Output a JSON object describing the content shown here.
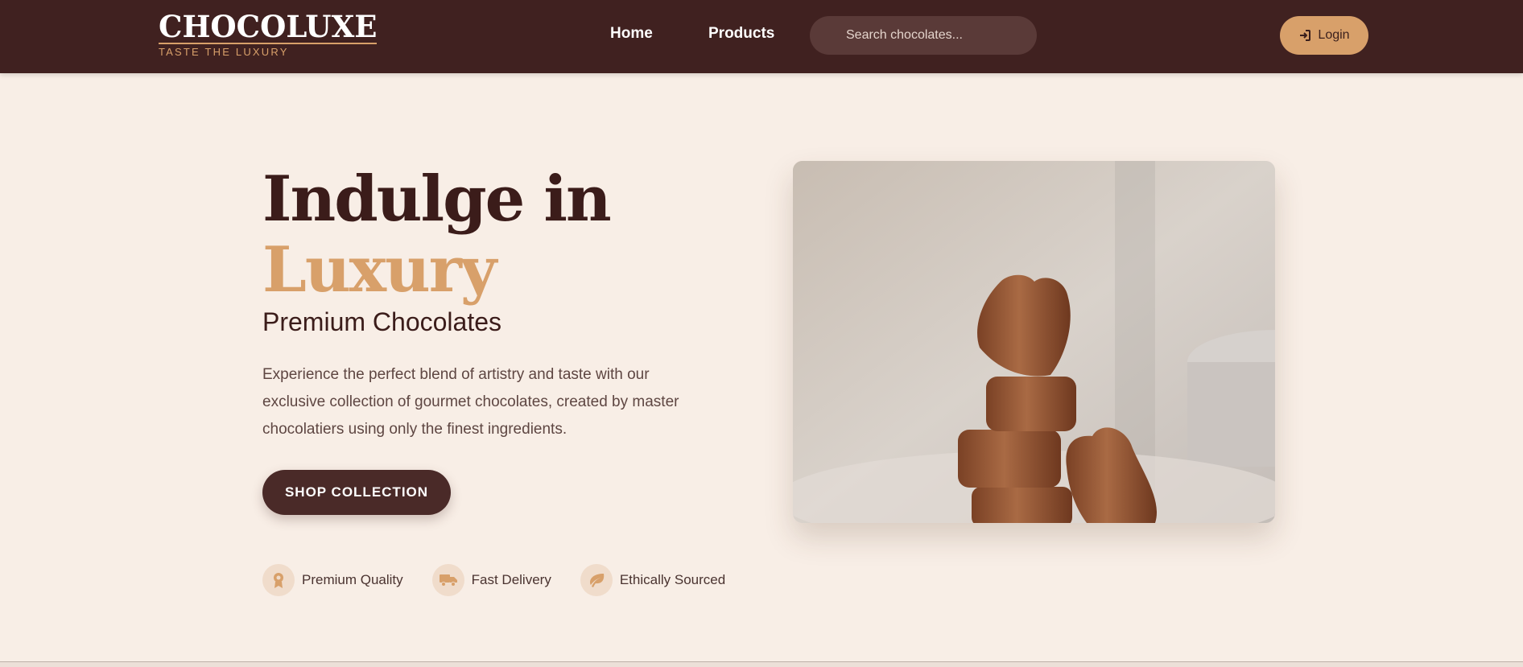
{
  "brand": {
    "name": "CHOCOLUXE",
    "tagline": "TASTE THE LUXURY"
  },
  "nav": {
    "home": "Home",
    "products": "Products"
  },
  "search": {
    "placeholder": "Search chocolates..."
  },
  "login": {
    "label": "Login",
    "icon": "sign-in-icon"
  },
  "hero": {
    "title_line1": "Indulge in",
    "title_line2": "Luxury",
    "subtitle": "Premium Chocolates",
    "description": "Experience the perfect blend of artistry and taste with our exclusive collection of gourmet chocolates, created by master chocolatiers using only the finest ingredients.",
    "cta": "SHOP COLLECTION"
  },
  "features": [
    {
      "label": "Premium Quality",
      "icon": "award-icon"
    },
    {
      "label": "Fast Delivery",
      "icon": "truck-icon"
    },
    {
      "label": "Ethically Sourced",
      "icon": "leaf-icon"
    }
  ],
  "colors": {
    "navbar": "#402120",
    "accent": "#d8a06a",
    "background": "#f8eee6",
    "dark_text": "#3b1c1a",
    "button_dark": "#4a2a28"
  }
}
